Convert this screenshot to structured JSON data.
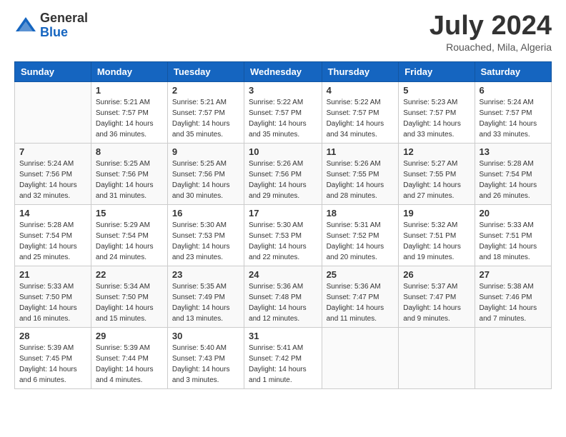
{
  "header": {
    "logo_general": "General",
    "logo_blue": "Blue",
    "month_title": "July 2024",
    "location": "Rouached, Mila, Algeria"
  },
  "days_of_week": [
    "Sunday",
    "Monday",
    "Tuesday",
    "Wednesday",
    "Thursday",
    "Friday",
    "Saturday"
  ],
  "weeks": [
    [
      {
        "day": "",
        "sunrise": "",
        "sunset": "",
        "daylight": ""
      },
      {
        "day": "1",
        "sunrise": "Sunrise: 5:21 AM",
        "sunset": "Sunset: 7:57 PM",
        "daylight": "Daylight: 14 hours and 36 minutes."
      },
      {
        "day": "2",
        "sunrise": "Sunrise: 5:21 AM",
        "sunset": "Sunset: 7:57 PM",
        "daylight": "Daylight: 14 hours and 35 minutes."
      },
      {
        "day": "3",
        "sunrise": "Sunrise: 5:22 AM",
        "sunset": "Sunset: 7:57 PM",
        "daylight": "Daylight: 14 hours and 35 minutes."
      },
      {
        "day": "4",
        "sunrise": "Sunrise: 5:22 AM",
        "sunset": "Sunset: 7:57 PM",
        "daylight": "Daylight: 14 hours and 34 minutes."
      },
      {
        "day": "5",
        "sunrise": "Sunrise: 5:23 AM",
        "sunset": "Sunset: 7:57 PM",
        "daylight": "Daylight: 14 hours and 33 minutes."
      },
      {
        "day": "6",
        "sunrise": "Sunrise: 5:24 AM",
        "sunset": "Sunset: 7:57 PM",
        "daylight": "Daylight: 14 hours and 33 minutes."
      }
    ],
    [
      {
        "day": "7",
        "sunrise": "Sunrise: 5:24 AM",
        "sunset": "Sunset: 7:56 PM",
        "daylight": "Daylight: 14 hours and 32 minutes."
      },
      {
        "day": "8",
        "sunrise": "Sunrise: 5:25 AM",
        "sunset": "Sunset: 7:56 PM",
        "daylight": "Daylight: 14 hours and 31 minutes."
      },
      {
        "day": "9",
        "sunrise": "Sunrise: 5:25 AM",
        "sunset": "Sunset: 7:56 PM",
        "daylight": "Daylight: 14 hours and 30 minutes."
      },
      {
        "day": "10",
        "sunrise": "Sunrise: 5:26 AM",
        "sunset": "Sunset: 7:56 PM",
        "daylight": "Daylight: 14 hours and 29 minutes."
      },
      {
        "day": "11",
        "sunrise": "Sunrise: 5:26 AM",
        "sunset": "Sunset: 7:55 PM",
        "daylight": "Daylight: 14 hours and 28 minutes."
      },
      {
        "day": "12",
        "sunrise": "Sunrise: 5:27 AM",
        "sunset": "Sunset: 7:55 PM",
        "daylight": "Daylight: 14 hours and 27 minutes."
      },
      {
        "day": "13",
        "sunrise": "Sunrise: 5:28 AM",
        "sunset": "Sunset: 7:54 PM",
        "daylight": "Daylight: 14 hours and 26 minutes."
      }
    ],
    [
      {
        "day": "14",
        "sunrise": "Sunrise: 5:28 AM",
        "sunset": "Sunset: 7:54 PM",
        "daylight": "Daylight: 14 hours and 25 minutes."
      },
      {
        "day": "15",
        "sunrise": "Sunrise: 5:29 AM",
        "sunset": "Sunset: 7:54 PM",
        "daylight": "Daylight: 14 hours and 24 minutes."
      },
      {
        "day": "16",
        "sunrise": "Sunrise: 5:30 AM",
        "sunset": "Sunset: 7:53 PM",
        "daylight": "Daylight: 14 hours and 23 minutes."
      },
      {
        "day": "17",
        "sunrise": "Sunrise: 5:30 AM",
        "sunset": "Sunset: 7:53 PM",
        "daylight": "Daylight: 14 hours and 22 minutes."
      },
      {
        "day": "18",
        "sunrise": "Sunrise: 5:31 AM",
        "sunset": "Sunset: 7:52 PM",
        "daylight": "Daylight: 14 hours and 20 minutes."
      },
      {
        "day": "19",
        "sunrise": "Sunrise: 5:32 AM",
        "sunset": "Sunset: 7:51 PM",
        "daylight": "Daylight: 14 hours and 19 minutes."
      },
      {
        "day": "20",
        "sunrise": "Sunrise: 5:33 AM",
        "sunset": "Sunset: 7:51 PM",
        "daylight": "Daylight: 14 hours and 18 minutes."
      }
    ],
    [
      {
        "day": "21",
        "sunrise": "Sunrise: 5:33 AM",
        "sunset": "Sunset: 7:50 PM",
        "daylight": "Daylight: 14 hours and 16 minutes."
      },
      {
        "day": "22",
        "sunrise": "Sunrise: 5:34 AM",
        "sunset": "Sunset: 7:50 PM",
        "daylight": "Daylight: 14 hours and 15 minutes."
      },
      {
        "day": "23",
        "sunrise": "Sunrise: 5:35 AM",
        "sunset": "Sunset: 7:49 PM",
        "daylight": "Daylight: 14 hours and 13 minutes."
      },
      {
        "day": "24",
        "sunrise": "Sunrise: 5:36 AM",
        "sunset": "Sunset: 7:48 PM",
        "daylight": "Daylight: 14 hours and 12 minutes."
      },
      {
        "day": "25",
        "sunrise": "Sunrise: 5:36 AM",
        "sunset": "Sunset: 7:47 PM",
        "daylight": "Daylight: 14 hours and 11 minutes."
      },
      {
        "day": "26",
        "sunrise": "Sunrise: 5:37 AM",
        "sunset": "Sunset: 7:47 PM",
        "daylight": "Daylight: 14 hours and 9 minutes."
      },
      {
        "day": "27",
        "sunrise": "Sunrise: 5:38 AM",
        "sunset": "Sunset: 7:46 PM",
        "daylight": "Daylight: 14 hours and 7 minutes."
      }
    ],
    [
      {
        "day": "28",
        "sunrise": "Sunrise: 5:39 AM",
        "sunset": "Sunset: 7:45 PM",
        "daylight": "Daylight: 14 hours and 6 minutes."
      },
      {
        "day": "29",
        "sunrise": "Sunrise: 5:39 AM",
        "sunset": "Sunset: 7:44 PM",
        "daylight": "Daylight: 14 hours and 4 minutes."
      },
      {
        "day": "30",
        "sunrise": "Sunrise: 5:40 AM",
        "sunset": "Sunset: 7:43 PM",
        "daylight": "Daylight: 14 hours and 3 minutes."
      },
      {
        "day": "31",
        "sunrise": "Sunrise: 5:41 AM",
        "sunset": "Sunset: 7:42 PM",
        "daylight": "Daylight: 14 hours and 1 minute."
      },
      {
        "day": "",
        "sunrise": "",
        "sunset": "",
        "daylight": ""
      },
      {
        "day": "",
        "sunrise": "",
        "sunset": "",
        "daylight": ""
      },
      {
        "day": "",
        "sunrise": "",
        "sunset": "",
        "daylight": ""
      }
    ]
  ]
}
